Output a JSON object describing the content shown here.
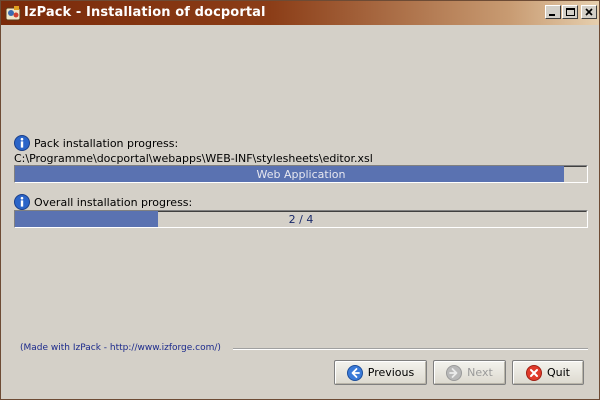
{
  "window": {
    "title": "IzPack - Installation of docportal",
    "controls": {
      "minimize": "_",
      "maximize": "□",
      "close": "x"
    }
  },
  "pack_progress": {
    "label": "Pack installation progress:",
    "current_file": "C:\\Programme\\docportal\\webapps\\WEB-INF\\stylesheets\\editor.xsl",
    "bar_text": "Web Application",
    "fraction": 0.96
  },
  "overall_progress": {
    "label": "Overall installation progress:",
    "bar_text": "2 / 4",
    "fraction": 0.25
  },
  "footer": {
    "made_with": "(Made with IzPack - http://www.izforge.com/)"
  },
  "buttons": {
    "previous": "Previous",
    "next": "Next",
    "quit": "Quit"
  },
  "colors": {
    "progress_fill": "#5a72b1",
    "titlebar_start": "#7a2a0a",
    "titlebar_end": "#e6cfae",
    "link_text": "#1c2a8c"
  },
  "icons": {
    "app": "izpack-logo-icon",
    "info": "info-icon",
    "previous": "arrow-left-icon",
    "next": "arrow-right-icon",
    "quit": "quit-icon"
  }
}
